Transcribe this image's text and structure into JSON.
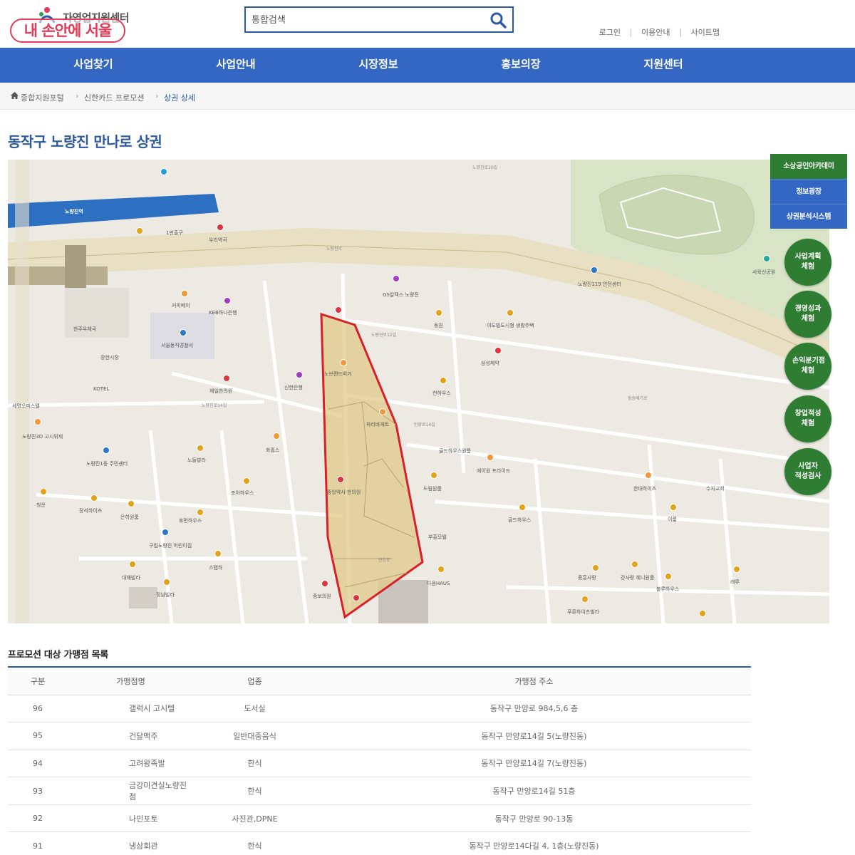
{
  "header": {
    "logo_text": "자영업지원센터",
    "watermark": "내 손안에 서울",
    "search_placeholder": "통합검색",
    "util_links": [
      "로그인",
      "이용안내",
      "사이트맵"
    ]
  },
  "nav": {
    "items": [
      "사업찾기",
      "사업안내",
      "시장정보",
      "홍보의장",
      "지원센터"
    ]
  },
  "breadcrumb": {
    "items": [
      "종합지원포털",
      "신한카드 프로모션",
      "상권 상세"
    ]
  },
  "page_title": "동작구 노량진 만나로 상권",
  "side_panel": {
    "buttons": [
      "소상공인아카데미",
      "정보광장",
      "상권분석시스템"
    ],
    "circles": [
      "사업계획 체험",
      "경영성과 체험",
      "손익분기점 체험",
      "창업적성 체험",
      "사업자 적성검사"
    ]
  },
  "map": {
    "station_label": "노량진역",
    "exit_label": "1번출구",
    "labels": [
      "우리약국",
      "GS칼텍스 노량진",
      "노량진119 안전센터",
      "사육신공원",
      "커피베이",
      "KEB하나은행",
      "서울동작경찰서",
      "한주우체국",
      "장한시장",
      "KOTEL",
      "세명오피스텔",
      "노량진3D 고시위제",
      "노량진1동 주민센터",
      "노량진역 2번출구",
      "노브랜드버거",
      "파리바게트",
      "신한은행",
      "제일한의원",
      "화홀스",
      "노들빌라",
      "조아하우스",
      "중앙약사 한의원",
      "동원",
      "이도빌도시형 생활주택",
      "삼성제약",
      "천하우스",
      "골드하우스원룸",
      "에이원 프라이드",
      "한대하이츠",
      "수지교회",
      "드림원룸",
      "골드하우스",
      "부흥모텔",
      "다음HAUS",
      "중흥사랑",
      "강사랑 헤니원룸",
      "블루하우스",
      "푸른하이츠빌라",
      "중보의원",
      "장석하이츠",
      "은하원룸",
      "청운",
      "휴먼하우스",
      "구립노량진 어린이집",
      "대해빌라",
      "정남빌라",
      "스텝하",
      "래루",
      "이룸"
    ],
    "roads": [
      "노량진로",
      "노량진로10길",
      "노량진로14길",
      "만양로14길",
      "만양로",
      "노량진로12길",
      "장승배기로"
    ],
    "highlight_color": "#e0c98a",
    "outline_color": "#d9202a"
  },
  "list": {
    "title": "프로모션 대상 가맹점 목록",
    "headers": [
      "구분",
      "가맹점명",
      "업종",
      "가맹점 주소"
    ],
    "rows": [
      {
        "no": "96",
        "name": "갤럭시 고시텔",
        "type": "도서실",
        "addr": "동작구 만양로 984,5,6 층"
      },
      {
        "no": "95",
        "name": "건달맥주",
        "type": "일반대중음식",
        "addr": "동작구 만양로14길 5(노량진동)"
      },
      {
        "no": "94",
        "name": "고려왕족발",
        "type": "한식",
        "addr": "동작구 만양로14길 7(노량진동)"
      },
      {
        "no": "93",
        "name": "금강미견실노량진점",
        "type": "한식",
        "addr": "동작구 만양로14길 51층"
      },
      {
        "no": "92",
        "name": "나인포토",
        "type": "사진관,DPNE",
        "addr": "동작구 만양로 90-13동"
      },
      {
        "no": "91",
        "name": "냉삼회관",
        "type": "한식",
        "addr": "동작구 만양로14다길 4, 1층(노량진동)"
      }
    ]
  }
}
